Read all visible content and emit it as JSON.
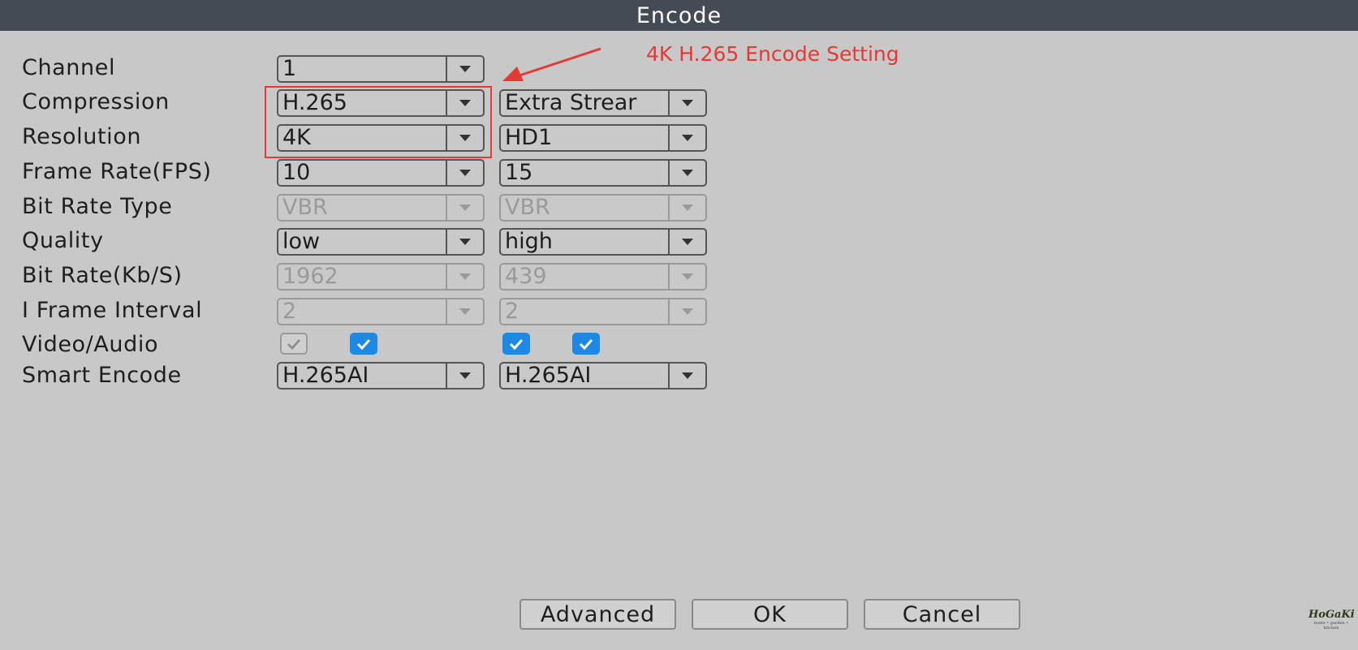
{
  "title": "Encode",
  "annotation": "4K H.265 Encode Setting",
  "rows": [
    {
      "label": "Channel"
    },
    {
      "label": "Compression"
    },
    {
      "label": "Resolution"
    },
    {
      "label": "Frame Rate(FPS)"
    },
    {
      "label": "Bit Rate Type"
    },
    {
      "label": "Quality"
    },
    {
      "label": "Bit Rate(Kb/S)"
    },
    {
      "label": "I Frame Interval"
    },
    {
      "label": "Video/Audio"
    },
    {
      "label": "Smart Encode"
    }
  ],
  "channel": {
    "value": "1"
  },
  "main": {
    "compression": "H.265",
    "resolution": "4K",
    "frame_rate": "10",
    "bit_rate_type": "VBR",
    "quality": "low",
    "bit_rate": "1962",
    "i_frame_interval": "2",
    "video_checked": true,
    "audio_checked": true,
    "smart_encode": "H.265AI"
  },
  "extra": {
    "compression": "Extra Strear",
    "resolution": "HD1",
    "frame_rate": "15",
    "bit_rate_type": "VBR",
    "quality": "high",
    "bit_rate": "439",
    "i_frame_interval": "2",
    "video_checked": true,
    "audio_checked": true,
    "smart_encode": "H.265AI"
  },
  "buttons": {
    "advanced": "Advanced",
    "ok": "OK",
    "cancel": "Cancel"
  },
  "logo": {
    "name": "HoGaKi",
    "tagline": "home • garden • kitchen"
  },
  "colors": {
    "titlebar": "#454b55",
    "background": "#c8c8c8",
    "checkbox": "#1e88e5",
    "annotation": "#e53935"
  }
}
